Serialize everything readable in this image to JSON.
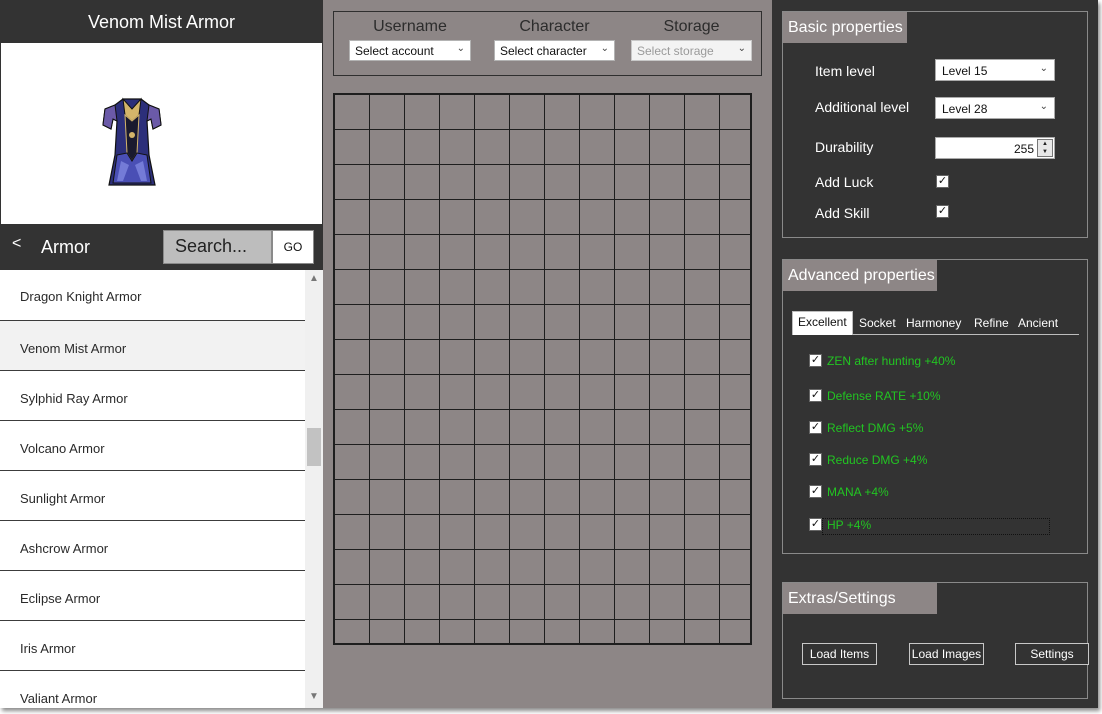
{
  "item_panel": {
    "title": "Venom Mist Armor",
    "category": {
      "back_label": "<",
      "name": "Armor"
    },
    "search": {
      "value": "Search...",
      "go_label": "GO"
    },
    "items": [
      "Dragon Knight Armor",
      "Venom Mist Armor",
      "Sylphid Ray Armor",
      "Volcano Armor",
      "Sunlight Armor",
      "Ashcrow Armor",
      "Eclipse Armor",
      "Iris Armor",
      "Valiant Armor"
    ],
    "selected_item": "Venom Mist Armor"
  },
  "selectors": {
    "username": {
      "label": "Username",
      "value": "Select account"
    },
    "character": {
      "label": "Character",
      "value": "Select character"
    },
    "storage": {
      "label": "Storage",
      "value": "Select storage"
    }
  },
  "inventory_grid": {
    "columns": 12,
    "rows": 16
  },
  "basic_properties": {
    "title": "Basic properties",
    "item_level": {
      "label": "Item level",
      "value": "Level 15"
    },
    "additional_level": {
      "label": "Additional level",
      "value": "Level 28"
    },
    "durability": {
      "label": "Durability",
      "value": "255"
    },
    "add_luck": {
      "label": "Add Luck",
      "checked": true
    },
    "add_skill": {
      "label": "Add Skill",
      "checked": true
    }
  },
  "advanced_properties": {
    "title": "Advanced properties",
    "tabs": [
      "Excellent",
      "Socket",
      "Harmoney",
      "Refine",
      "Ancient"
    ],
    "active_tab": "Excellent",
    "options": [
      {
        "label": "ZEN after hunting +40%",
        "checked": true
      },
      {
        "label": "Defense RATE +10%",
        "checked": true
      },
      {
        "label": "Reflect DMG +5%",
        "checked": true
      },
      {
        "label": "Reduce DMG +4%",
        "checked": true
      },
      {
        "label": "MANA +4%",
        "checked": true
      },
      {
        "label": "HP +4%",
        "checked": true
      }
    ],
    "option_color": "#22c522"
  },
  "extras": {
    "title": "Extras/Settings",
    "buttons": {
      "load_items": "Load Items",
      "load_images": "Load Images",
      "settings": "Settings"
    }
  },
  "colors": {
    "dark_panel": "#333333",
    "grid_bg": "#8d8686",
    "header_tab": "#8d8686"
  },
  "icons": {
    "checkbox": "checkmark",
    "dropdown": "chevron-down-icon",
    "armor": "armor-icon"
  }
}
